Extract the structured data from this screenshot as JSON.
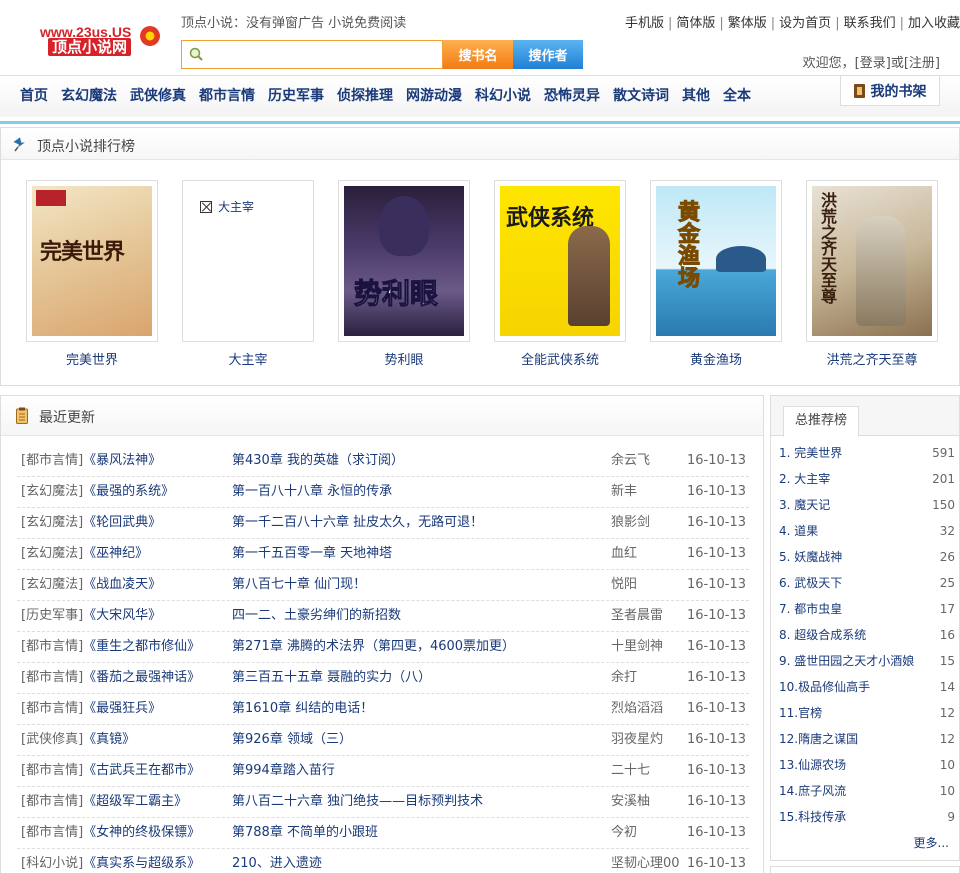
{
  "header": {
    "logo_url_text": "www.23us.US",
    "logo_cn_text": "顶点小说网",
    "slogan": "顶点小说：没有弹窗广告 小说免费阅读",
    "search": {
      "placeholder": "",
      "btn_title": "搜书名",
      "btn_author": "搜作者"
    },
    "toplinks": [
      "手机版",
      "简体版",
      "繁体版",
      "设为首页",
      "联系我们",
      "加入收藏"
    ],
    "welcome": {
      "prefix": "欢迎您，",
      "login": "[登录]",
      "mid": "或",
      "register": "[注册]"
    }
  },
  "nav": {
    "items": [
      "首页",
      "玄幻魔法",
      "武侠修真",
      "都市言情",
      "历史军事",
      "侦探推理",
      "网游动漫",
      "科幻小说",
      "恐怖灵异",
      "散文诗词",
      "其他",
      "全本"
    ],
    "bookshelf": "我的书架"
  },
  "ranking": {
    "title": "顶点小说排行榜",
    "books": [
      {
        "title": "完美世界",
        "cover_text": "完美世界"
      },
      {
        "title": "大主宰",
        "cover_text": "大主宰",
        "broken": true
      },
      {
        "title": "势利眼",
        "cover_text": "势利眼"
      },
      {
        "title": "全能武侠系统",
        "cover_text": "武侠系统"
      },
      {
        "title": "黄金渔场",
        "cover_text": "黄金渔场"
      },
      {
        "title": "洪荒之齐天至尊",
        "cover_text": "洪荒之齐天至尊"
      }
    ]
  },
  "recent": {
    "title": "最近更新",
    "rows": [
      {
        "cat": "[都市言情]",
        "book": "《暴风法神》",
        "chapter": "第430章 我的英雄（求订阅）",
        "author": "余云飞",
        "date": "16-10-13"
      },
      {
        "cat": "[玄幻魔法]",
        "book": "《最强的系统》",
        "chapter": "第一百八十八章 永恒的传承",
        "author": "新丰",
        "date": "16-10-13"
      },
      {
        "cat": "[玄幻魔法]",
        "book": "《轮回武典》",
        "chapter": "第一千二百八十六章 扯皮太久，无路可退！",
        "author": "狼影剑",
        "date": "16-10-13"
      },
      {
        "cat": "[玄幻魔法]",
        "book": "《巫神纪》",
        "chapter": "第一千五百零一章 天地神塔",
        "author": "血红",
        "date": "16-10-13"
      },
      {
        "cat": "[玄幻魔法]",
        "book": "《战血凌天》",
        "chapter": "第八百七十章 仙门现！",
        "author": "悦阳",
        "date": "16-10-13"
      },
      {
        "cat": "[历史军事]",
        "book": "《大宋风华》",
        "chapter": "四一二、土豪劣绅们的新招数",
        "author": "圣者晨雷",
        "date": "16-10-13"
      },
      {
        "cat": "[都市言情]",
        "book": "《重生之都市修仙》",
        "chapter": "第271章 沸腾的术法界（第四更，4600票加更）",
        "author": "十里剑神",
        "date": "16-10-13"
      },
      {
        "cat": "[都市言情]",
        "book": "《番茄之最强神话》",
        "chapter": "第三百五十五章 聂融的实力（八）",
        "author": "余打",
        "date": "16-10-13"
      },
      {
        "cat": "[都市言情]",
        "book": "《最强狂兵》",
        "chapter": "第1610章 纠结的电话！",
        "author": "烈焰滔滔",
        "date": "16-10-13"
      },
      {
        "cat": "[武侠修真]",
        "book": "《真镜》",
        "chapter": "第926章 领域（三）",
        "author": "羽夜星灼",
        "date": "16-10-13"
      },
      {
        "cat": "[都市言情]",
        "book": "《古武兵王在都市》",
        "chapter": "第994章踏入苗行",
        "author": "二十七",
        "date": "16-10-13"
      },
      {
        "cat": "[都市言情]",
        "book": "《超级军工霸主》",
        "chapter": "第八百二十六章 独门绝技——目标预判技术",
        "author": "安溪柚",
        "date": "16-10-13"
      },
      {
        "cat": "[都市言情]",
        "book": "《女神的终极保镖》",
        "chapter": "第788章 不简单的小跟班",
        "author": "今初",
        "date": "16-10-13"
      },
      {
        "cat": "[科幻小说]",
        "book": "《真实系与超级系》",
        "chapter": "210、进入遗迹",
        "author": "坚韧心理00",
        "date": "16-10-13"
      }
    ]
  },
  "recommend": {
    "tab": "总推荐榜",
    "items": [
      {
        "rank": "1.",
        "name": "完美世界",
        "count": "591"
      },
      {
        "rank": "2.",
        "name": "大主宰",
        "count": "201"
      },
      {
        "rank": "3.",
        "name": "魔天记",
        "count": "150"
      },
      {
        "rank": "4.",
        "name": "道果",
        "count": "32"
      },
      {
        "rank": "5.",
        "name": "妖魔战神",
        "count": "26"
      },
      {
        "rank": "6.",
        "name": "武极天下",
        "count": "25"
      },
      {
        "rank": "7.",
        "name": "都市虫皇",
        "count": "17"
      },
      {
        "rank": "8.",
        "name": "超级合成系统",
        "count": "16"
      },
      {
        "rank": "9.",
        "name": "盛世田园之天才小酒娘",
        "count": "15"
      },
      {
        "rank": "10.",
        "name": "极品修仙高手",
        "count": "14"
      },
      {
        "rank": "11.",
        "name": "官榜",
        "count": "12"
      },
      {
        "rank": "12.",
        "name": "隋唐之谋国",
        "count": "12"
      },
      {
        "rank": "13.",
        "name": "仙源农场",
        "count": "10"
      },
      {
        "rank": "14.",
        "name": "庶子风流",
        "count": "10"
      },
      {
        "rank": "15.",
        "name": "科技传承",
        "count": "9"
      }
    ],
    "more": "更多..."
  },
  "colors": {
    "link": "#1a3a7a",
    "accent_orange": "#f27b12",
    "accent_blue": "#1f80d6",
    "nav_line": "#7fd0e6",
    "logo_red": "#d8222a"
  }
}
